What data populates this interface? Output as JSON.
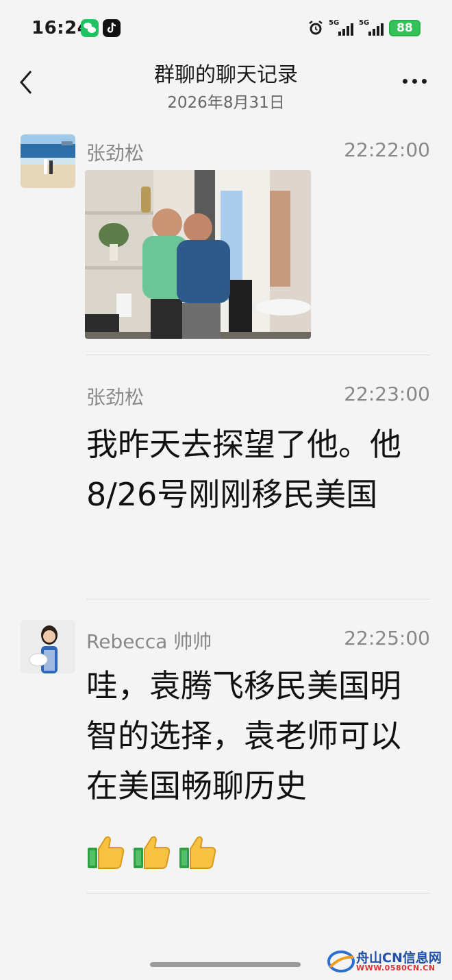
{
  "status_bar": {
    "time": "16:24",
    "network_1": "5G",
    "network_2": "5G",
    "battery": "88"
  },
  "header": {
    "title": "群聊的聊天记录",
    "subtitle": "2026年8月31日"
  },
  "messages": [
    {
      "sender": "张劲松",
      "time": "22:22:00",
      "type": "image"
    },
    {
      "sender": "张劲松",
      "time": "22:23:00",
      "text": "我昨天去探望了他。他8/26号刚刚移民美国"
    },
    {
      "sender": "Rebecca 帅帅",
      "time": "22:25:00",
      "text": "哇，袁腾飞移民美国明智的选择，袁老师可以在美国畅聊历史"
    }
  ],
  "watermark": {
    "name": "舟山CN信息网",
    "url": "WWW.0580CN.CN"
  },
  "colors": {
    "background": "#f4f4f4",
    "battery": "#35c05a",
    "wechat_green": "#20c160",
    "muted_text": "#888888"
  },
  "icons": [
    "back-icon",
    "more-icon",
    "alarm-icon",
    "thumbs-up-icon",
    "wechat-icon",
    "tiktok-icon"
  ]
}
